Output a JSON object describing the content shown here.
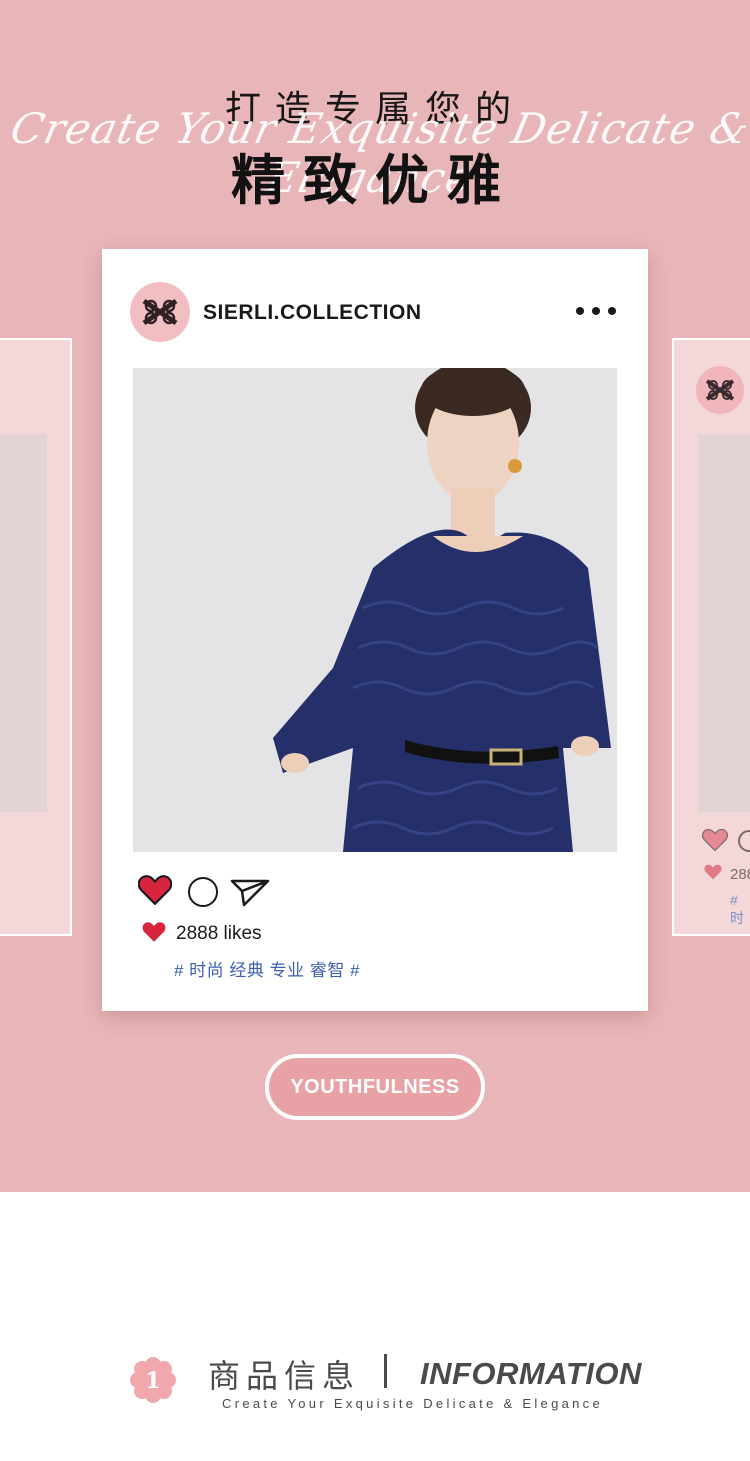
{
  "hero": {
    "headline_top": "打造专属您的",
    "headline_script": "Create Your Exquisite Delicate & Elegance",
    "headline_main": "精致优雅"
  },
  "post": {
    "account_name": "SIERLI.COLLECTION",
    "likes_text": "2888 likes",
    "hashtags": "# 时尚 经典 专业 睿智 #",
    "photo_icon": "model-in-navy-lace-dress-photo",
    "heart_color": "#d8253f"
  },
  "side_card_right": {
    "likes_text": "288",
    "hashtags": "# 时"
  },
  "pill": {
    "label": "YOUTHFULNESS"
  },
  "info": {
    "number": "1",
    "title_cn": "商品信息",
    "title_en": "INFORMATION",
    "subtitle": "Create Your Exquisite Delicate & Elegance"
  },
  "colors": {
    "hero_bg": "#e8b6b8",
    "card_bg": "#ffffff",
    "accent_pink": "#e8a1a4",
    "hashtag_blue": "#3c5fae"
  }
}
